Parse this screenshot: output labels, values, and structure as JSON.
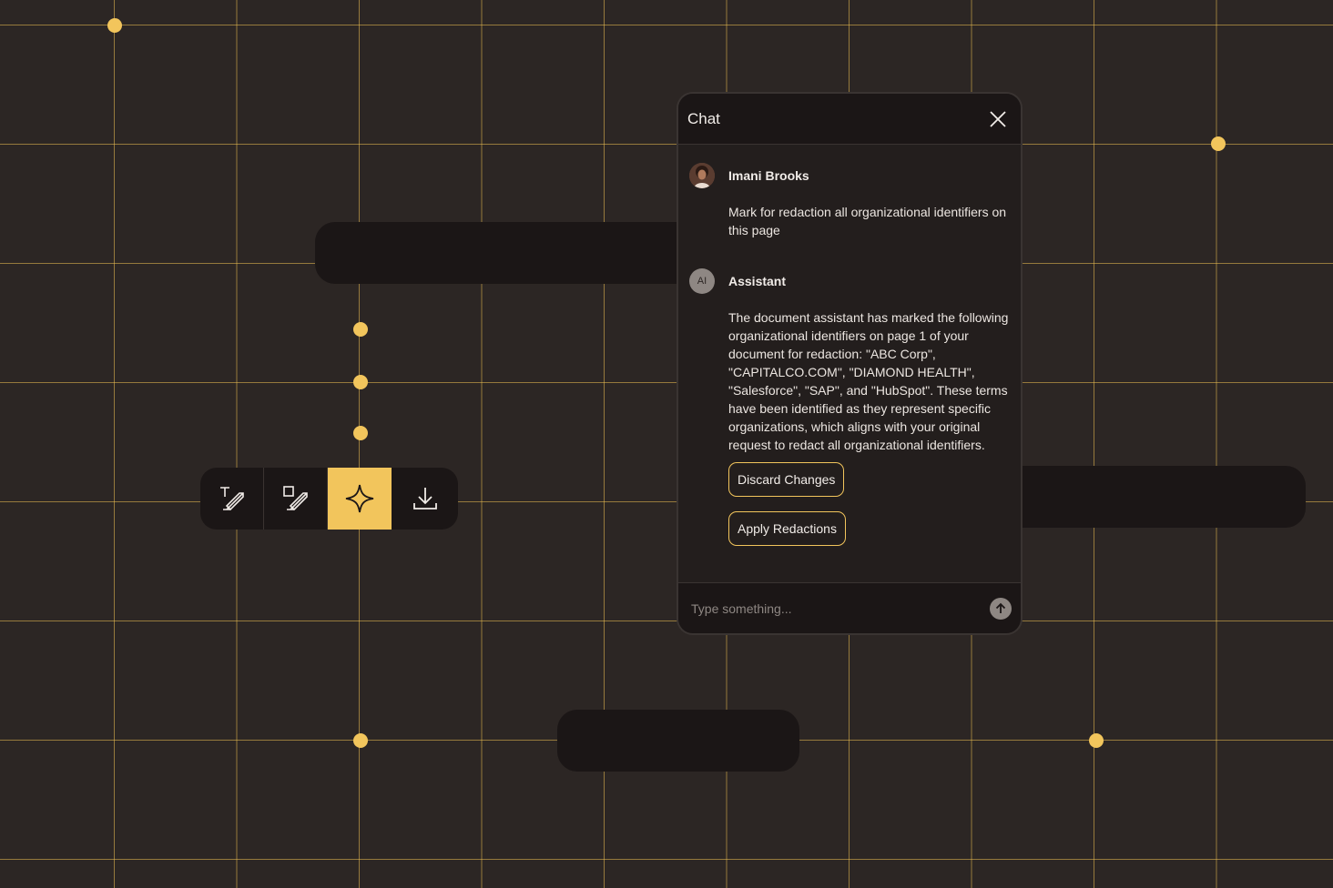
{
  "chat": {
    "title": "Chat",
    "messages": [
      {
        "sender": "Imani Brooks",
        "avatar": "user-photo",
        "text": "Mark for redaction all organizational identifiers on this page"
      },
      {
        "sender": "Assistant",
        "avatar_text": "AI",
        "text": "The document assistant has marked the following organizational identifiers on page 1 of your document for redaction: \"ABC Corp\", \"CAPITALCO.COM\", \"DIAMOND HEALTH\", \"Salesforce\", \"SAP\", and \"HubSpot\". These terms have been identified as they represent specific organizations, which aligns with your original request to redact all organizational identifiers."
      }
    ],
    "actions": {
      "discard_label": "Discard Changes",
      "apply_label": "Apply Redactions"
    },
    "composer": {
      "placeholder": "Type something...",
      "value": ""
    }
  },
  "toolbar": {
    "tools": [
      {
        "icon": "text-redact-icon",
        "active": false
      },
      {
        "icon": "area-redact-icon",
        "active": false
      },
      {
        "icon": "ai-sparkle-icon",
        "active": true
      },
      {
        "icon": "download-icon",
        "active": false
      }
    ]
  },
  "colors": {
    "background": "#2c2624",
    "accent": "#f2c55c",
    "panel": "#1b1616"
  }
}
